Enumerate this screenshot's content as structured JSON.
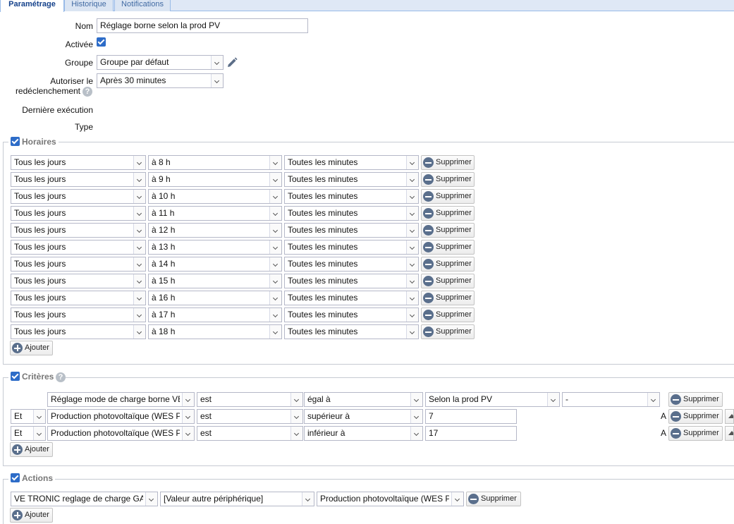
{
  "tabs": [
    {
      "label": "Paramétrage",
      "active": true
    },
    {
      "label": "Historique",
      "active": false
    },
    {
      "label": "Notifications",
      "active": false
    }
  ],
  "form": {
    "name_label": "Nom",
    "name_value": "Réglage borne selon la prod PV",
    "enabled_label": "Activée",
    "enabled_checked": true,
    "group_label": "Groupe",
    "group_value": "Groupe par défaut",
    "retrigger_label_line1": "Autoriser le",
    "retrigger_label_line2": "redéclenchement",
    "retrigger_value": "Après 30 minutes",
    "last_run_label": "Dernière exécution",
    "type_label": "Type"
  },
  "schedules": {
    "legend": "Horaires",
    "enabled": true,
    "delete_label": "Supprimer",
    "add_label": "Ajouter",
    "rows": [
      {
        "day": "Tous les jours",
        "hour": "à 8 h",
        "minute": "Toutes les minutes"
      },
      {
        "day": "Tous les jours",
        "hour": "à 9 h",
        "minute": "Toutes les minutes"
      },
      {
        "day": "Tous les jours",
        "hour": "à 10 h",
        "minute": "Toutes les minutes"
      },
      {
        "day": "Tous les jours",
        "hour": "à 11 h",
        "minute": "Toutes les minutes"
      },
      {
        "day": "Tous les jours",
        "hour": "à 12 h",
        "minute": "Toutes les minutes"
      },
      {
        "day": "Tous les jours",
        "hour": "à 13 h",
        "minute": "Toutes les minutes"
      },
      {
        "day": "Tous les jours",
        "hour": "à 14 h",
        "minute": "Toutes les minutes"
      },
      {
        "day": "Tous les jours",
        "hour": "à 15 h",
        "minute": "Toutes les minutes"
      },
      {
        "day": "Tous les jours",
        "hour": "à 16 h",
        "minute": "Toutes les minutes"
      },
      {
        "day": "Tous les jours",
        "hour": "à 17 h",
        "minute": "Toutes les minutes"
      },
      {
        "day": "Tous les jours",
        "hour": "à 18 h",
        "minute": "Toutes les minutes"
      }
    ]
  },
  "criteria": {
    "legend": "Critères",
    "enabled": true,
    "delete_label": "Supprimer",
    "add_label": "Ajouter",
    "rows": [
      {
        "logic": "",
        "subject": "Réglage mode de charge borne VE",
        "verb": "est",
        "operator": "égal à",
        "value": "Selon la prod PV",
        "extra": "-",
        "trail": ""
      },
      {
        "logic": "Et",
        "subject": "Production photovoltaïque (WES Pi",
        "verb": "est",
        "operator": "supérieur à",
        "value": "7",
        "extra": "",
        "trail": "A"
      },
      {
        "logic": "Et",
        "subject": "Production photovoltaïque (WES Pi",
        "verb": "est",
        "operator": "inférieur à",
        "value": "17",
        "extra": "",
        "trail": "A"
      }
    ]
  },
  "actions": {
    "legend": "Actions",
    "enabled": true,
    "delete_label": "Supprimer",
    "add_label": "Ajouter",
    "rows": [
      {
        "device": "VE TRONIC reglage de charge GAR",
        "mode": "[Valeur autre périphérique]",
        "source": "Production photovoltaïque (WES Pi"
      }
    ]
  },
  "colors": {
    "accent": "#2d6cc8",
    "tab_bg": "#dfe8f6",
    "tab_text": "#15428b",
    "border": "#b5b8c8"
  }
}
